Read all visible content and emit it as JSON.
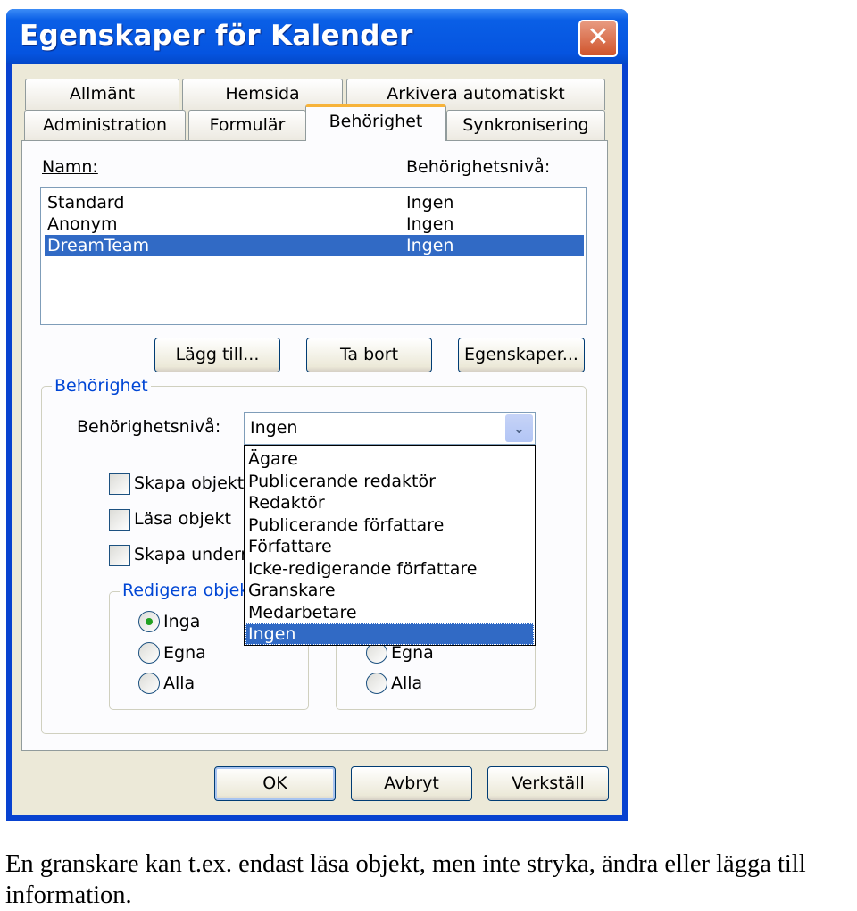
{
  "window": {
    "title": "Egenskaper för Kalender",
    "close_icon": "close-icon"
  },
  "tabs": {
    "row1": [
      {
        "label": "Allmänt"
      },
      {
        "label": "Hemsida"
      },
      {
        "label": "Arkivera automatiskt"
      }
    ],
    "row2": [
      {
        "label": "Administration"
      },
      {
        "label": "Formulär"
      },
      {
        "label": "Behörighet",
        "selected": true
      },
      {
        "label": "Synkronisering"
      }
    ]
  },
  "permissions_list": {
    "name_header": "Namn:",
    "level_header": "Behörighetsnivå:",
    "rows": [
      {
        "name": "Standard",
        "level": "Ingen"
      },
      {
        "name": "Anonym",
        "level": "Ingen"
      },
      {
        "name": "DreamTeam",
        "level": "Ingen",
        "selected": true
      }
    ]
  },
  "list_buttons": {
    "add": "Lägg till...",
    "remove": "Ta bort",
    "properties": "Egenskaper..."
  },
  "permission_group": {
    "title": "Behörighet",
    "level_label": "Behörighetsnivå:",
    "level_value": "Ingen",
    "level_options": [
      "Ägare",
      "Publicerande redaktör",
      "Redaktör",
      "Publicerande författare",
      "Författare",
      "Icke-redigerande författare",
      "Granskare",
      "Medarbetare",
      "Ingen"
    ],
    "checkboxes": [
      {
        "label": "Skapa objekt",
        "checked": false
      },
      {
        "label": "Läsa objekt",
        "checked": false
      },
      {
        "label": "Skapa underm",
        "checked": false
      }
    ],
    "edit_group": {
      "title": "Redigera objek",
      "options": [
        {
          "label": "Inga",
          "checked": true
        },
        {
          "label": "Egna",
          "checked": false
        },
        {
          "label": "Alla",
          "checked": false
        }
      ]
    },
    "delete_group": {
      "options": [
        {
          "label": "Egna",
          "checked": false
        },
        {
          "label": "Alla",
          "checked": false
        }
      ]
    }
  },
  "footer_buttons": {
    "ok": "OK",
    "cancel": "Avbryt",
    "apply": "Verkställ"
  },
  "caption": "En granskare kan t.ex. endast läsa objekt, men inte stryka, ändra eller lägga till information.",
  "colors": {
    "titlebar": "#0554e0",
    "selection": "#316ac5",
    "group_label": "#0046d5",
    "dialog_bg": "#ece9d8"
  }
}
